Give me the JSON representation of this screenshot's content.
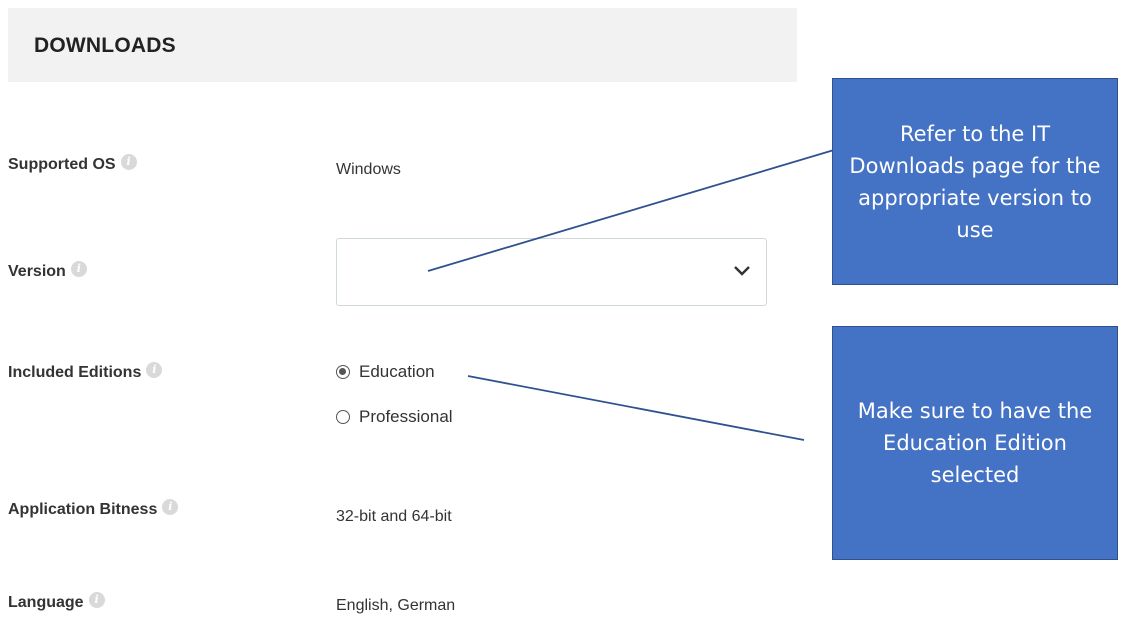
{
  "section": {
    "title": "DOWNLOADS"
  },
  "fields": {
    "supported_os": {
      "label": "Supported OS",
      "value": "Windows"
    },
    "version": {
      "label": "Version",
      "selected": ""
    },
    "included_editions": {
      "label": "Included Editions",
      "options": [
        {
          "label": "Education",
          "checked": true
        },
        {
          "label": "Professional",
          "checked": false
        }
      ]
    },
    "application_bitness": {
      "label": "Application Bitness",
      "value": "32-bit and 64-bit"
    },
    "language": {
      "label": "Language",
      "value": "English, German"
    }
  },
  "icons": {
    "info": "info-icon",
    "dropdown": "chevron-down-icon"
  },
  "callouts": {
    "version_note": "Refer to the IT Downloads page for the appropriate version to use",
    "edition_note": "Make sure to have the Education Edition selected"
  },
  "colors": {
    "callout_fill": "#4472c4",
    "callout_border": "#2f528f",
    "header_bg": "#f2f2f2"
  }
}
